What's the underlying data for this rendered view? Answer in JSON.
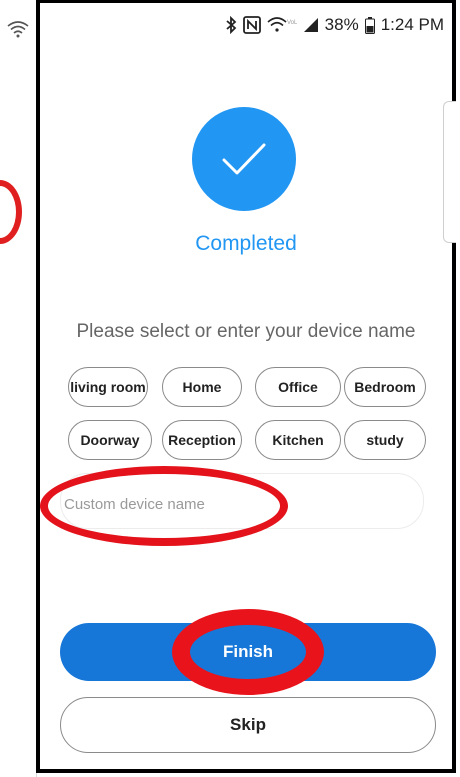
{
  "status_bar": {
    "battery_percent": "38%",
    "time": "1:24 PM",
    "icons": [
      "wifi-icon",
      "bluetooth-icon",
      "nfc-icon",
      "wifi-calling-icon",
      "signal-icon",
      "battery-icon"
    ]
  },
  "completion": {
    "icon": "checkmark-icon",
    "label": "Completed"
  },
  "prompt": "Please select or enter your device name",
  "chips_row1": [
    "living room",
    "Home",
    "Office",
    "Bedroom"
  ],
  "chips_row2": [
    "Doorway",
    "Reception",
    "Kitchen",
    "study"
  ],
  "custom_name": {
    "placeholder": "Custom device name",
    "value": ""
  },
  "buttons": {
    "finish": "Finish",
    "skip": "Skip"
  },
  "colors": {
    "accent": "#2196f3",
    "primary_button": "#1677d9",
    "annotation_red": "#e4131b"
  }
}
